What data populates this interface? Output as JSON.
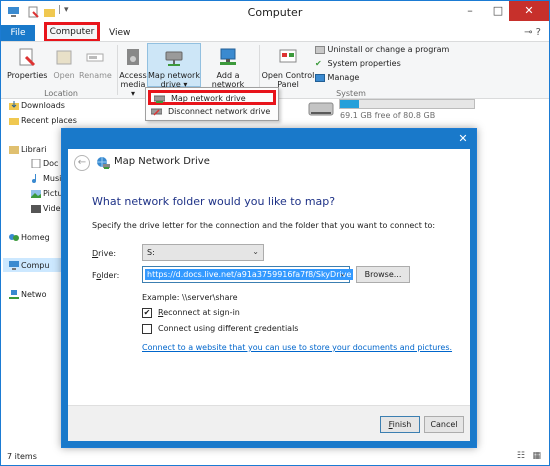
{
  "window": {
    "title": "Computer",
    "minimize": "–",
    "maximize": "□",
    "close": "✕"
  },
  "ribbon": {
    "tabs": {
      "file": "File",
      "computer": "Computer",
      "view": "View"
    },
    "buttons": {
      "properties": "Properties",
      "open": "Open",
      "rename": "Rename",
      "access_media_1": "Access",
      "access_media_2": "media ▾",
      "map_drive_1": "Map network",
      "map_drive_2": "drive ▾",
      "add_location_1": "Add a network",
      "add_location_2": "location",
      "open_cp_1": "Open Control",
      "open_cp_2": "Panel",
      "uninstall": "Uninstall or change a program",
      "system_props": "System properties",
      "manage": "Manage"
    },
    "groups": {
      "location": "Location",
      "system": "System"
    },
    "dropdown": {
      "map": "Map network drive",
      "disconnect": "Disconnect network drive"
    }
  },
  "drive": {
    "free_text": "69.1 GB free of 80.8 GB",
    "used_fraction": 0.145
  },
  "nav": {
    "downloads": "Downloads",
    "recent": "Recent places",
    "libraries": "Librari",
    "docs": "Doc",
    "music": "Musi",
    "pictures": "Pictu",
    "videos": "Vide",
    "homegroup": "Homeg",
    "computer": "Compu",
    "network": "Netwo"
  },
  "status": {
    "items": "7 items"
  },
  "dialog": {
    "title": "Map Network Drive",
    "close": "✕",
    "back": "←",
    "question": "What network folder would you like to map?",
    "instruction": "Specify the drive letter for the connection and the folder that you want to connect to:",
    "drive_label_key": "D",
    "drive_label_rest": "rive:",
    "drive_value": "S:",
    "folder_label_key": "o",
    "folder_label_pre": "F",
    "folder_label_post": "lder:",
    "folder_value": "https://d.docs.live.net/a91a3759916fa7f8/SkyDrive",
    "browse": "Browse...",
    "example": "Example: \\\\server\\share",
    "reconnect_key": "R",
    "reconnect_rest": "econnect at sign-in",
    "different_pre": "Connect using different ",
    "different_key": "c",
    "different_rest": "redentials",
    "link": "Connect to a website that you can use to store your documents and pictures.",
    "finish_key": "F",
    "finish_rest": "inish",
    "cancel": "Cancel",
    "reconnect_checked": true,
    "different_checked": false
  }
}
